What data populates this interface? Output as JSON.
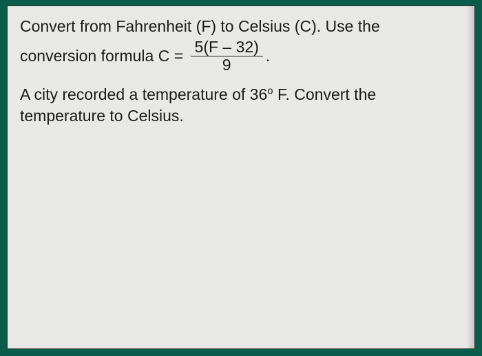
{
  "problem": {
    "intro": "Convert from Fahrenheit (F) to Celsius (C). Use the",
    "formula_lead": "conversion formula C = ",
    "fraction_num_a": "5(F ",
    "fraction_num_minus": "–",
    "fraction_num_b": " 32)",
    "fraction_den": "9",
    "formula_trail": ".",
    "question_a": "A city recorded a temperature of 36",
    "degree": "o",
    "question_b": " F. Convert the temperature to Celsius."
  }
}
